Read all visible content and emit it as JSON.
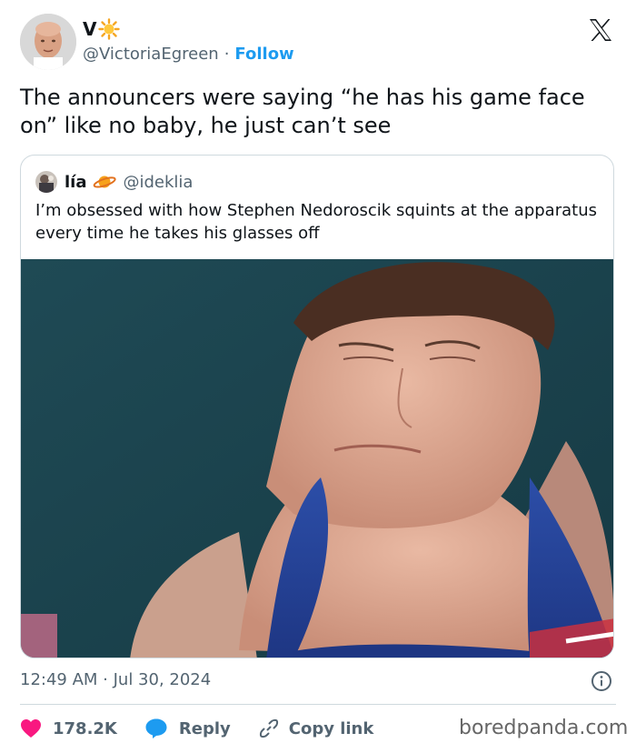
{
  "author": {
    "display_name": "V",
    "badge_icon": "sun-emoji-icon",
    "handle": "@VictoriaEgreen",
    "separator": "·",
    "follow_label": "Follow"
  },
  "platform_logo": "x-logo-icon",
  "tweet": {
    "text": "The announcers were saying “he has his game face on” like no baby, he just can’t see",
    "timestamp": "12:49 AM · Jul 30, 2024"
  },
  "quoted_tweet": {
    "display_name": "lía",
    "badge_icon": "planet-emoji-icon",
    "handle": "@ideklia",
    "text": "I’m obsessed with how Stephen Nedoroscik squints at the apparatus every time he takes his glasses off"
  },
  "actions": {
    "likes_count": "178.2K",
    "reply_label": "Reply",
    "copy_link_label": "Copy link"
  },
  "watermark": "boredpanda.com",
  "colors": {
    "accent": "#1d9bf0",
    "text_primary": "#0f1419",
    "text_secondary": "#536471",
    "like_heart": "#f91880",
    "border": "#cfd9de"
  }
}
